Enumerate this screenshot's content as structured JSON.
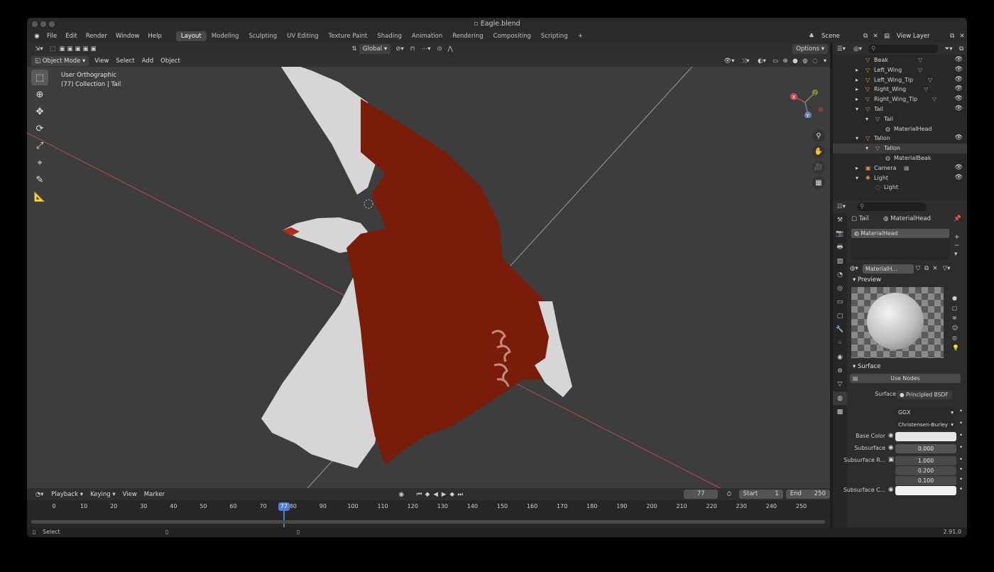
{
  "window": {
    "title": "Eagle.blend"
  },
  "menu": {
    "items": [
      "File",
      "Edit",
      "Render",
      "Window",
      "Help"
    ],
    "workspaces": [
      "Layout",
      "Modeling",
      "Sculpting",
      "UV Editing",
      "Texture Paint",
      "Shading",
      "Animation",
      "Rendering",
      "Compositing",
      "Scripting"
    ],
    "active_workspace": "Layout",
    "add_workspace": "+",
    "scene": "Scene",
    "view_layer": "View Layer"
  },
  "viewport": {
    "transform_orientation": "Global",
    "options_label": "Options",
    "mode": "Object Mode",
    "menus": [
      "View",
      "Select",
      "Add",
      "Object"
    ],
    "view_name": "User Orthographic",
    "collection_info": "(77) Collection | Tail",
    "gizmo": {
      "x": "X",
      "y": "Y",
      "z": "Z"
    }
  },
  "outliner": {
    "rows": [
      {
        "label": "Beak",
        "icon": "mesh-icon",
        "eye": false
      },
      {
        "label": "Left_Wing",
        "icon": "mesh-icon",
        "eye": true
      },
      {
        "label": "Left_Wing_Tip",
        "icon": "mesh-icon",
        "eye": true
      },
      {
        "label": "Right_Wing",
        "icon": "mesh-icon",
        "eye": true
      },
      {
        "label": "Right_Wing_Tip",
        "icon": "mesh-icon",
        "eye": true
      },
      {
        "label": "Tail",
        "icon": "mesh-icon",
        "eye": true
      },
      {
        "label": "Tail",
        "icon": "mesh-data-icon",
        "eye": false
      },
      {
        "label": "MaterialHead",
        "icon": "material-icon",
        "eye": false
      },
      {
        "label": "Tallon",
        "icon": "mesh-icon",
        "eye": true
      },
      {
        "label": "Tallon",
        "icon": "mesh-data-icon",
        "eye": false
      },
      {
        "label": "MaterialBeak",
        "icon": "material-icon",
        "eye": false
      },
      {
        "label": "Camera",
        "icon": "camera-icon",
        "eye": true
      },
      {
        "label": "Light",
        "icon": "light-icon",
        "eye": true
      },
      {
        "label": "Light",
        "icon": "light-data-icon",
        "eye": false
      }
    ],
    "selected_row": 9
  },
  "properties": {
    "breadcrumb_object": "Tail",
    "breadcrumb_material": "MaterialHead",
    "material_slot": "MaterialHead",
    "material_name": "MaterialH...",
    "preview_label": "Preview",
    "surface_panel": "Surface",
    "use_nodes": "Use Nodes",
    "surface_label": "Surface",
    "surface_value": "Principled BSDF",
    "distribution": "GGX",
    "subsurface_method": "Christensen-Burley",
    "base_color_label": "Base Color",
    "subsurface_label": "Subsurface",
    "subsurface_value": "0.000",
    "subsurface_radius_label": "Subsurface R...",
    "subsurface_radius": [
      "1.000",
      "0.200",
      "0.100"
    ],
    "subsurface_color_label": "Subsurface C...",
    "base_color": "#e6e6e6"
  },
  "timeline": {
    "menus": [
      "Playback",
      "Keying",
      "View",
      "Marker"
    ],
    "current_frame": "77",
    "start_label": "Start",
    "start": "1",
    "end_label": "End",
    "end": "250",
    "ticks": [
      "0",
      "10",
      "20",
      "30",
      "40",
      "50",
      "60",
      "70",
      "80",
      "90",
      "100",
      "110",
      "120",
      "130",
      "140",
      "150",
      "160",
      "170",
      "180",
      "190",
      "200",
      "210",
      "220",
      "230",
      "240",
      "250"
    ]
  },
  "status": {
    "select_label": "Select",
    "version": "2.91.0"
  },
  "colors": {
    "body_red": "#7a1c0a",
    "feather_white": "#d7d7d7",
    "viewport_bg": "#3d3d3d"
  }
}
